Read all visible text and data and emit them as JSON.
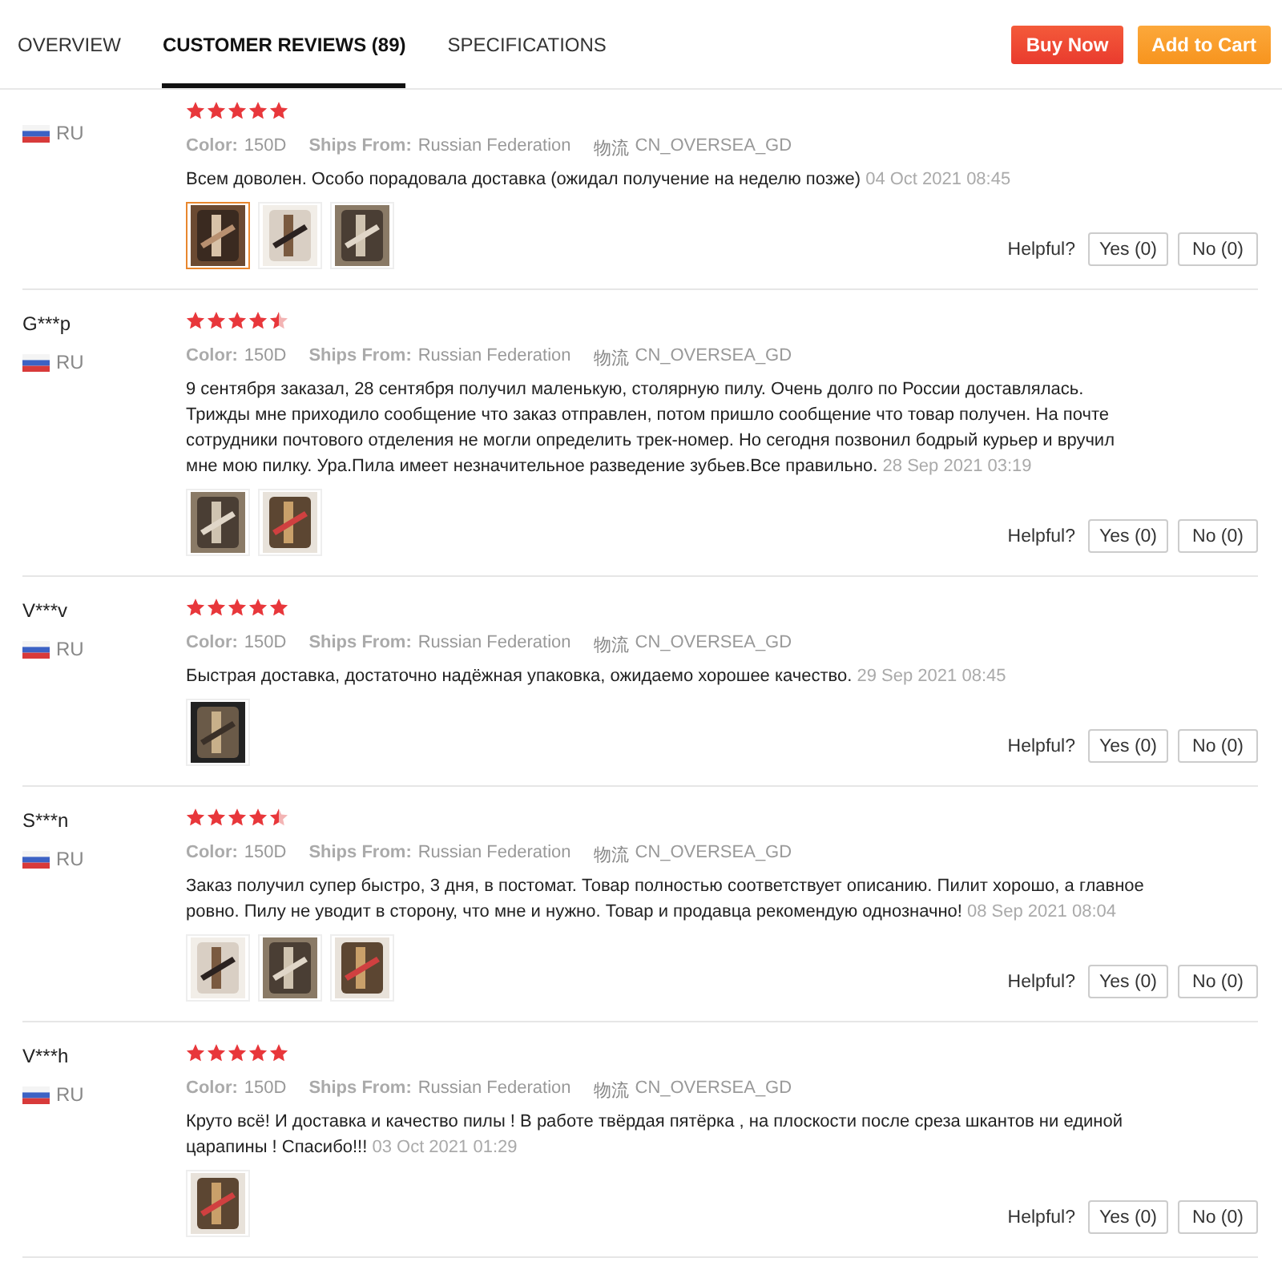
{
  "tabs": [
    {
      "label": "OVERVIEW",
      "selected": false
    },
    {
      "label": "CUSTOMER REVIEWS (89)",
      "selected": true
    },
    {
      "label": "SPECIFICATIONS",
      "selected": false
    }
  ],
  "actions": [
    {
      "label": "Buy Now",
      "kind": "buy"
    },
    {
      "label": "Add to Cart",
      "kind": "cart"
    }
  ],
  "reviews": [
    {
      "country": "RU",
      "stars": 5,
      "attributes": [
        {
          "label": "Color:",
          "value": "150D"
        },
        {
          "label": "Ships From:",
          "value": "Russian Federation"
        },
        {
          "label": "物流",
          "value": "CN_OVERSEA_GD"
        }
      ],
      "text": "Всем доволен. Особо порадовала доставка (ожидал получение на неделю позже)",
      "date": "04 Oct 2021 08:45",
      "photos": [
        {
          "selected": true
        },
        {
          "selected": false
        },
        {
          "selected": false
        }
      ],
      "helpful": "Helpful?",
      "yes": "Yes (0)",
      "no": "No (0)"
    },
    {
      "user": "G***p",
      "country": "RU",
      "stars": 4.5,
      "attributes": [
        {
          "label": "Color:",
          "value": "150D"
        },
        {
          "label": "Ships From:",
          "value": "Russian Federation"
        },
        {
          "label": "物流",
          "value": "CN_OVERSEA_GD"
        }
      ],
      "text": "9 сентября заказал, 28 сентября получил маленькую, столярную пилу. Очень долго по России доставлялась. Трижды мне приходило сообщение что заказ отправлен, потом пришло сообщение что товар получен. На почте сотрудники почтового отделения не могли определить трек-номер. Но сегодня позвонил бодрый курьер и вручил мне мою пилку. Ура.Пила имеет незначительное разведение зубьев.Все правильно.",
      "date": "28 Sep 2021 03:19",
      "photos": [
        {
          "selected": false
        },
        {
          "selected": false
        }
      ],
      "helpful": "Helpful?",
      "yes": "Yes (0)",
      "no": "No (0)"
    },
    {
      "user": "V***v",
      "country": "RU",
      "stars": 5,
      "attributes": [
        {
          "label": "Color:",
          "value": "150D"
        },
        {
          "label": "Ships From:",
          "value": "Russian Federation"
        },
        {
          "label": "物流",
          "value": "CN_OVERSEA_GD"
        }
      ],
      "text": "Быстрая доставка, достаточно надёжная упаковка, ожидаемо хорошее качество.",
      "date": "29 Sep 2021 08:45",
      "photos": [
        {
          "selected": false
        }
      ],
      "helpful": "Helpful?",
      "yes": "Yes (0)",
      "no": "No (0)"
    },
    {
      "user": "S***n",
      "country": "RU",
      "stars": 4.5,
      "attributes": [
        {
          "label": "Color:",
          "value": "150D"
        },
        {
          "label": "Ships From:",
          "value": "Russian Federation"
        },
        {
          "label": "物流",
          "value": "CN_OVERSEA_GD"
        }
      ],
      "text": "Заказ получил супер быстро, 3 дня, в постомат. Товар полностью соответствует описанию. Пилит хорошо, а главное ровно. Пилу не уводит в сторону, что мне и нужно. Товар и продавца рекомендую однозначно!",
      "date": "08 Sep 2021 08:04",
      "photos": [
        {
          "selected": false
        },
        {
          "selected": false
        },
        {
          "selected": false
        }
      ],
      "helpful": "Helpful?",
      "yes": "Yes (0)",
      "no": "No (0)"
    },
    {
      "user": "V***h",
      "country": "RU",
      "stars": 5,
      "attributes": [
        {
          "label": "Color:",
          "value": "150D"
        },
        {
          "label": "Ships From:",
          "value": "Russian Federation"
        },
        {
          "label": "物流",
          "value": "CN_OVERSEA_GD"
        }
      ],
      "text": "Круто всё! И доставка и качество пилы ! В работе твёрдая пятёрка , на плоскости после среза шкантов ни единой царапины ! Спасибо!!!",
      "date": "03 Oct 2021 01:29",
      "photos": [
        {
          "selected": false
        }
      ],
      "helpful": "Helpful?",
      "yes": "Yes (0)",
      "no": "No (0)"
    }
  ]
}
